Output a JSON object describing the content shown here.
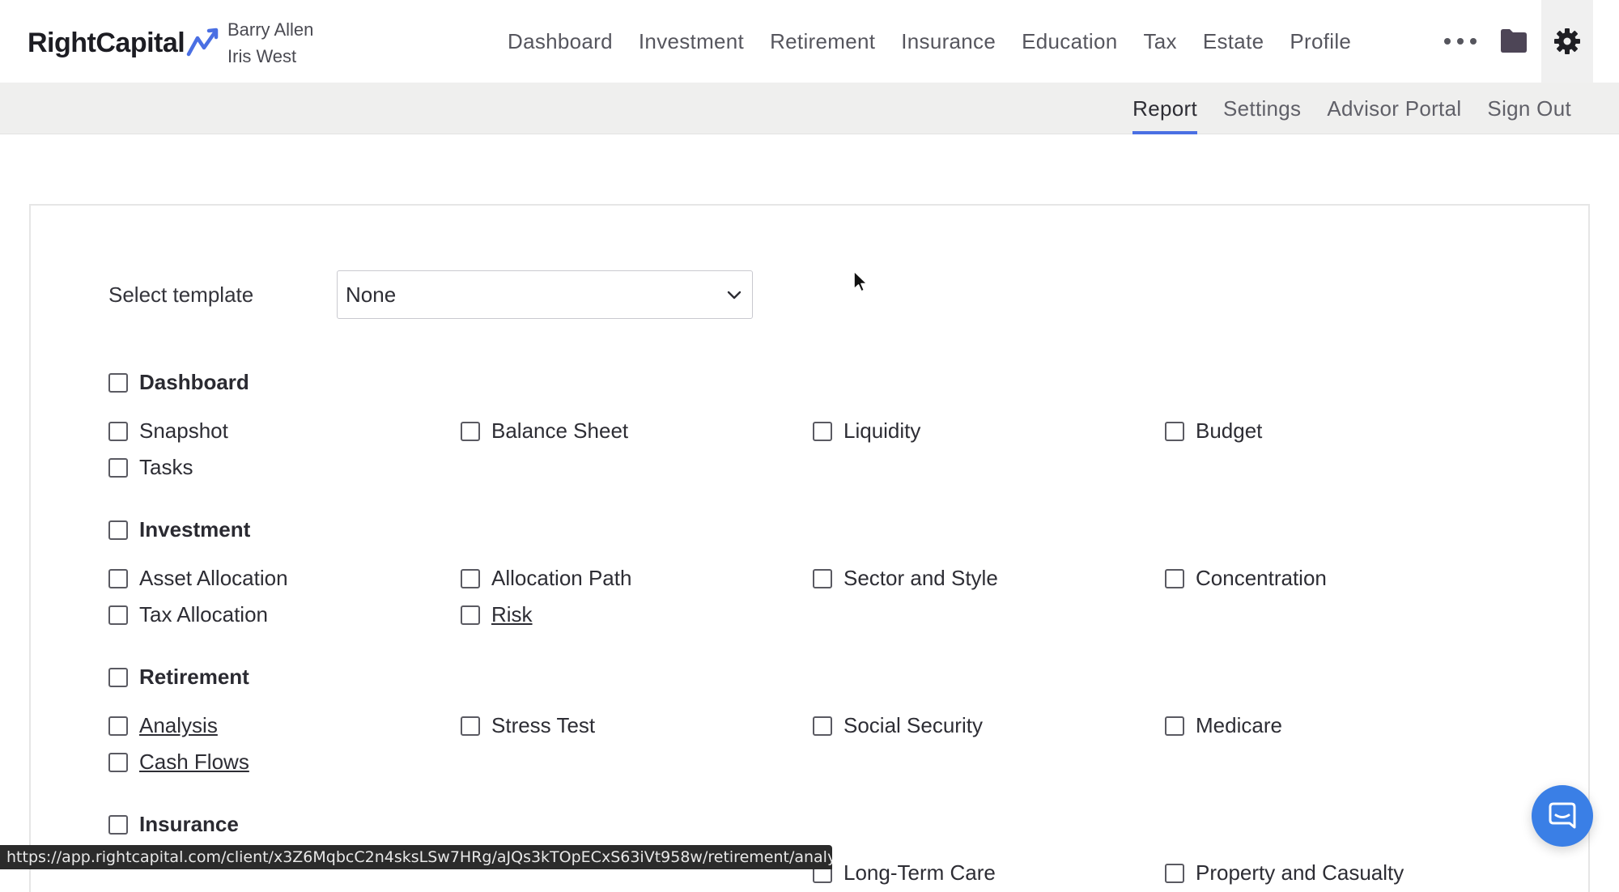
{
  "brand": {
    "name": "RightCapital",
    "accent": "#4a6fe3"
  },
  "clients": [
    "Barry Allen",
    "Iris West"
  ],
  "main_nav": [
    "Dashboard",
    "Investment",
    "Retirement",
    "Insurance",
    "Education",
    "Tax",
    "Estate",
    "Profile"
  ],
  "icons": {
    "more": "more-icon",
    "folder": "folder-icon",
    "settings": "gear-icon",
    "chat": "chat-icon",
    "dropdown": "chevron-down-icon"
  },
  "sub_nav": [
    {
      "label": "Report",
      "active": true
    },
    {
      "label": "Settings",
      "active": false
    },
    {
      "label": "Advisor Portal",
      "active": false
    },
    {
      "label": "Sign Out",
      "active": false
    }
  ],
  "template": {
    "label": "Select template",
    "value": "None"
  },
  "sections": [
    {
      "title": "Dashboard",
      "items": [
        "Snapshot",
        "Balance Sheet",
        "Liquidity",
        "Budget",
        "Tasks"
      ]
    },
    {
      "title": "Investment",
      "items": [
        "Asset Allocation",
        "Allocation Path",
        "Sector and Style",
        "Concentration",
        "Tax Allocation",
        "Risk"
      ]
    },
    {
      "title": "Retirement",
      "items": [
        "Analysis",
        "Stress Test",
        "Social Security",
        "Medicare",
        "Cash Flows"
      ]
    },
    {
      "title": "Insurance",
      "items": [
        "Long-Term Care",
        "Property and Casualty"
      ]
    }
  ],
  "status_url": "https://app.rightcapital.com/client/x3Z6MqbcC2n4sksLSw7HRg/aJQs3kTOpECxS63iVt958w/retirement/analysis"
}
